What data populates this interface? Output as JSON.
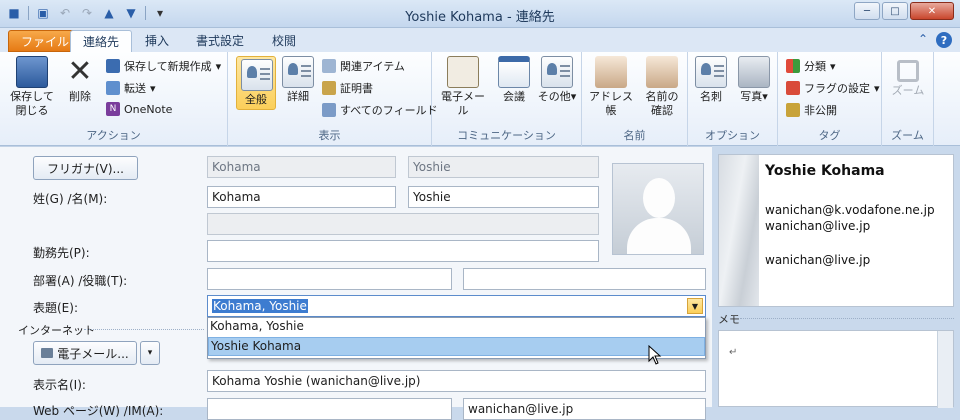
{
  "window": {
    "title": "Yoshie Kohama - 連絡先"
  },
  "tabs": [
    {
      "label": "ファイル"
    },
    {
      "label": "連絡先"
    },
    {
      "label": "挿入"
    },
    {
      "label": "書式設定"
    },
    {
      "label": "校閲"
    }
  ],
  "ribbon": {
    "actions": {
      "group_label": "アクション",
      "save_close": "保存して\n閉じる",
      "delete": "削除",
      "save_new": "保存して新規作成",
      "forward": "転送",
      "onenote": "OneNote"
    },
    "show": {
      "group_label": "表示",
      "general": "全般",
      "details": "詳細",
      "related": "関連アイテム",
      "certificates": "証明書",
      "all_fields": "すべてのフィールド"
    },
    "communicate": {
      "group_label": "コミュニケーション",
      "email": "電子メール",
      "meeting": "会議",
      "more": "その他"
    },
    "names": {
      "group_label": "名前",
      "address_book": "アドレス帳",
      "check_names": "名前の\n確認"
    },
    "options": {
      "group_label": "オプション",
      "business_card": "名刺",
      "picture": "写真"
    },
    "tags": {
      "group_label": "タグ",
      "categorize": "分類",
      "follow_up": "フラグの設定",
      "private": "非公開"
    },
    "zoom": {
      "group_label": "ズーム",
      "zoom": "ズーム"
    }
  },
  "form": {
    "furigana_button": "フリガナ(V)...",
    "furigana_last": "Kohama",
    "furigana_first": "Yoshie",
    "name_label": "姓(G) /名(M):",
    "last_name": "Kohama",
    "first_name": "Yoshie",
    "company_label": "勤務先(P):",
    "dept_label": "部署(A) /役職(T):",
    "fileas_label": "表題(E):",
    "fileas_value": "Kohama, Yoshie",
    "fileas_options": [
      "Kohama, Yoshie",
      "Yoshie Kohama"
    ],
    "internet_label": "インターネット",
    "email_button": "電子メール...",
    "display_label": "表示名(I):",
    "display_value": "Kohama Yoshie  (wanichan@live.jp)",
    "web_label": "Web ページ(W) /IM(A):",
    "im_value": "wanichan@live.jp"
  },
  "business_card": {
    "name": "Yoshie Kohama",
    "lines": [
      "wanichan@k.vodafone.ne.jp",
      "wanichan@live.jp",
      "wanichan@live.jp"
    ]
  },
  "memo": {
    "label": "メモ"
  }
}
